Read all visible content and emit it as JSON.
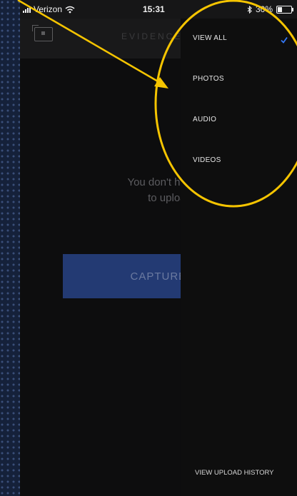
{
  "status_bar": {
    "carrier": "Verizon",
    "time": "15:31",
    "battery": "30%"
  },
  "nav": {
    "title": "EVIDENCE"
  },
  "main": {
    "empty_line1": "You don't have an",
    "empty_line2": "to upload",
    "capture_button": "CAPTURE EVI"
  },
  "filter_menu": {
    "items": [
      {
        "label": "VIEW ALL",
        "selected": true
      },
      {
        "label": "PHOTOS",
        "selected": false
      },
      {
        "label": "AUDIO",
        "selected": false
      },
      {
        "label": "VIDEOS",
        "selected": false
      }
    ],
    "footer_link": "VIEW UPLOAD HISTORY"
  },
  "colors": {
    "accent_check": "#3478f6",
    "annotation": "#f5c400",
    "button": "#233a73"
  }
}
